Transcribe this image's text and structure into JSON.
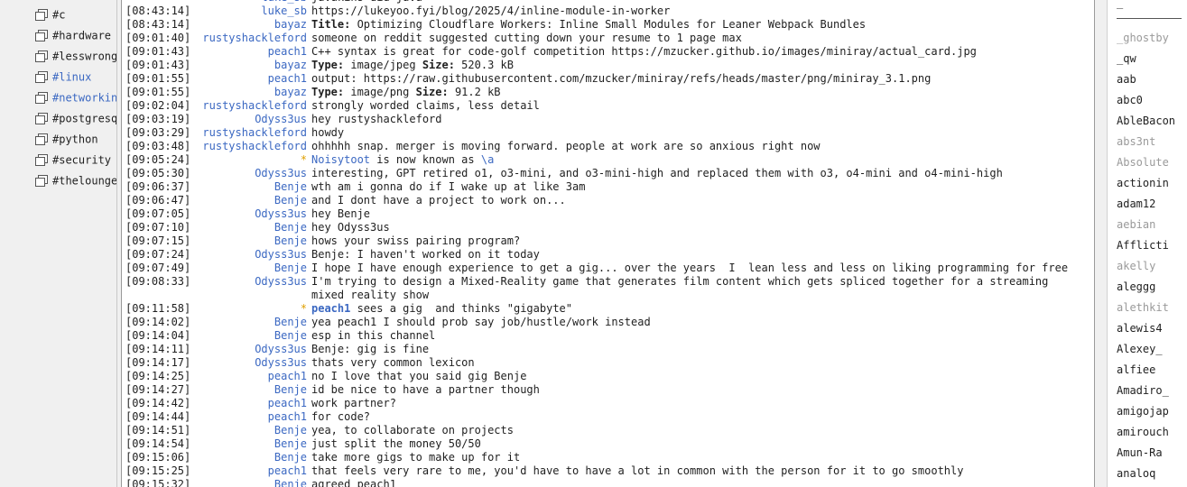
{
  "channels": [
    {
      "name": "#c",
      "active": false
    },
    {
      "name": "#hardware",
      "active": false
    },
    {
      "name": "#lesswrong",
      "active": false
    },
    {
      "name": "#linux",
      "active": true
    },
    {
      "name": "#networking",
      "active": true
    },
    {
      "name": "#postgresql",
      "active": false
    },
    {
      "name": "#python",
      "active": false
    },
    {
      "name": "#security",
      "active": false
    },
    {
      "name": "#thelounge",
      "active": false
    }
  ],
  "messages": [
    {
      "ts": "",
      "nick": "luke_sb",
      "type": "normal",
      "parts": [
        {
          "t": "javakins did java"
        }
      ]
    },
    {
      "ts": "[08:43:14]",
      "nick": "luke_sb",
      "type": "normal",
      "parts": [
        {
          "t": "https://lukeyoo.fyi/blog/2025/4/inline-module-in-worker"
        }
      ]
    },
    {
      "ts": "[08:43:14]",
      "nick": "bayaz",
      "type": "normal",
      "parts": [
        {
          "t": "Title:",
          "b": true
        },
        {
          "t": " Optimizing Cloudflare Workers: Inline Small Modules for Leaner Webpack Bundles"
        }
      ]
    },
    {
      "ts": "[09:01:40]",
      "nick": "rustyshackleford",
      "type": "normal",
      "parts": [
        {
          "t": "someone on reddit suggested cutting down your resume to 1 page max"
        }
      ]
    },
    {
      "ts": "[09:01:43]",
      "nick": "peach1",
      "type": "normal",
      "parts": [
        {
          "t": "C++ syntax is great for code-golf competition https://mzucker.github.io/images/miniray/actual_card.jpg"
        }
      ]
    },
    {
      "ts": "[09:01:43]",
      "nick": "bayaz",
      "type": "normal",
      "parts": [
        {
          "t": "Type:",
          "b": true
        },
        {
          "t": " image/jpeg "
        },
        {
          "t": "Size:",
          "b": true
        },
        {
          "t": " 520.3 kB"
        }
      ]
    },
    {
      "ts": "[09:01:55]",
      "nick": "peach1",
      "type": "normal",
      "parts": [
        {
          "t": "output: https://raw.githubusercontent.com/mzucker/miniray/refs/heads/master/png/miniray_3.1.png"
        }
      ]
    },
    {
      "ts": "[09:01:55]",
      "nick": "bayaz",
      "type": "normal",
      "parts": [
        {
          "t": "Type:",
          "b": true
        },
        {
          "t": " image/png "
        },
        {
          "t": "Size:",
          "b": true
        },
        {
          "t": " 91.2 kB"
        }
      ]
    },
    {
      "ts": "[09:02:04]",
      "nick": "rustyshackleford",
      "type": "normal",
      "parts": [
        {
          "t": "strongly worded claims, less detail"
        }
      ]
    },
    {
      "ts": "[09:03:19]",
      "nick": "Odyss3us",
      "type": "normal",
      "parts": [
        {
          "t": "hey rustyshackleford"
        }
      ]
    },
    {
      "ts": "[09:03:29]",
      "nick": "rustyshackleford",
      "type": "normal",
      "parts": [
        {
          "t": "howdy"
        }
      ]
    },
    {
      "ts": "[09:03:48]",
      "nick": "rustyshackleford",
      "type": "normal",
      "parts": [
        {
          "t": "ohhhhh snap. merger is moving forward. people at work are so anxious right now"
        }
      ]
    },
    {
      "ts": "[09:05:24]",
      "nick": "*",
      "type": "action",
      "parts": [
        {
          "t": "Noisytoot",
          "l": true
        },
        {
          "t": " is now known as "
        },
        {
          "t": "\\a",
          "l": true
        }
      ]
    },
    {
      "ts": "[09:05:30]",
      "nick": "Odyss3us",
      "type": "normal",
      "parts": [
        {
          "t": "interesting, GPT retired o1, o3-mini, and o3-mini-high and replaced them with o3, o4-mini and o4-mini-high"
        }
      ]
    },
    {
      "ts": "[09:06:37]",
      "nick": "Benje",
      "type": "normal",
      "parts": [
        {
          "t": "wth am i gonna do if I wake up at like 3am"
        }
      ]
    },
    {
      "ts": "[09:06:47]",
      "nick": "Benje",
      "type": "normal",
      "parts": [
        {
          "t": "and I dont have a project to work on..."
        }
      ]
    },
    {
      "ts": "[09:07:05]",
      "nick": "Odyss3us",
      "type": "normal",
      "parts": [
        {
          "t": "hey Benje"
        }
      ]
    },
    {
      "ts": "[09:07:10]",
      "nick": "Benje",
      "type": "normal",
      "parts": [
        {
          "t": "hey Odyss3us"
        }
      ]
    },
    {
      "ts": "[09:07:15]",
      "nick": "Benje",
      "type": "normal",
      "parts": [
        {
          "t": "hows your swiss pairing program?"
        }
      ]
    },
    {
      "ts": "[09:07:24]",
      "nick": "Odyss3us",
      "type": "normal",
      "parts": [
        {
          "t": "Benje: I haven't worked on it today"
        }
      ]
    },
    {
      "ts": "[09:07:49]",
      "nick": "Benje",
      "type": "normal",
      "parts": [
        {
          "t": "I hope I have enough experience to get a gig... over the years  I  lean less and less on liking programming for free"
        }
      ]
    },
    {
      "ts": "[09:08:33]",
      "nick": "Odyss3us",
      "type": "normal",
      "parts": [
        {
          "t": "I'm trying to design a Mixed-Reality game that generates film content which gets spliced together for a streaming mixed reality show"
        }
      ]
    },
    {
      "ts": "[09:11:58]",
      "nick": "*",
      "type": "action",
      "parts": [
        {
          "t": "peach1",
          "l": true,
          "b": true
        },
        {
          "t": " sees a gig  and thinks \"gigabyte\""
        }
      ]
    },
    {
      "ts": "[09:14:02]",
      "nick": "Benje",
      "type": "normal",
      "parts": [
        {
          "t": "yea peach1 I should prob say job/hustle/work instead"
        }
      ]
    },
    {
      "ts": "[09:14:04]",
      "nick": "Benje",
      "type": "normal",
      "parts": [
        {
          "t": "esp in this channel"
        }
      ]
    },
    {
      "ts": "[09:14:11]",
      "nick": "Odyss3us",
      "type": "normal",
      "parts": [
        {
          "t": "Benje: gig is fine"
        }
      ]
    },
    {
      "ts": "[09:14:17]",
      "nick": "Odyss3us",
      "type": "normal",
      "parts": [
        {
          "t": "thats very common lexicon"
        }
      ]
    },
    {
      "ts": "[09:14:25]",
      "nick": "peach1",
      "type": "normal",
      "parts": [
        {
          "t": "no I love that you said gig Benje"
        }
      ]
    },
    {
      "ts": "[09:14:27]",
      "nick": "Benje",
      "type": "normal",
      "parts": [
        {
          "t": "id be nice to have a partner though"
        }
      ]
    },
    {
      "ts": "[09:14:42]",
      "nick": "peach1",
      "type": "normal",
      "parts": [
        {
          "t": "work partner?"
        }
      ]
    },
    {
      "ts": "[09:14:44]",
      "nick": "peach1",
      "type": "normal",
      "parts": [
        {
          "t": "for code?"
        }
      ]
    },
    {
      "ts": "[09:14:51]",
      "nick": "Benje",
      "type": "normal",
      "parts": [
        {
          "t": "yea, to collaborate on projects"
        }
      ]
    },
    {
      "ts": "[09:14:54]",
      "nick": "Benje",
      "type": "normal",
      "parts": [
        {
          "t": "just split the money 50/50"
        }
      ]
    },
    {
      "ts": "[09:15:06]",
      "nick": "Benje",
      "type": "normal",
      "parts": [
        {
          "t": "take more gigs to make up for it"
        }
      ]
    },
    {
      "ts": "[09:15:25]",
      "nick": "peach1",
      "type": "normal",
      "parts": [
        {
          "t": "that feels very rare to me, you'd have to have a lot in common with the person for it to go smoothly"
        }
      ]
    },
    {
      "ts": "[09:15:32]",
      "nick": "Benje",
      "type": "normal",
      "parts": [
        {
          "t": "agreed peach1"
        }
      ]
    }
  ],
  "users_header": "_",
  "users": [
    {
      "name": "_ghostby",
      "away": true
    },
    {
      "name": "_qw",
      "away": false
    },
    {
      "name": "aab",
      "away": false
    },
    {
      "name": "abc0",
      "away": false
    },
    {
      "name": "AbleBacon",
      "away": false
    },
    {
      "name": "abs3nt",
      "away": true
    },
    {
      "name": "Absolute",
      "away": true
    },
    {
      "name": "actionin",
      "away": false
    },
    {
      "name": "adam12",
      "away": false
    },
    {
      "name": "aebian",
      "away": true
    },
    {
      "name": "Afflicti",
      "away": false
    },
    {
      "name": "akelly",
      "away": true
    },
    {
      "name": "aleggg",
      "away": false
    },
    {
      "name": "alethkit",
      "away": true
    },
    {
      "name": "alewis4",
      "away": false
    },
    {
      "name": "Alexey_",
      "away": false
    },
    {
      "name": "alfiee",
      "away": false
    },
    {
      "name": "Amadiro_",
      "away": false
    },
    {
      "name": "amigojap",
      "away": false
    },
    {
      "name": "amirouch",
      "away": false
    },
    {
      "name": "Amun-Ra",
      "away": false
    },
    {
      "name": "analoq",
      "away": false
    }
  ]
}
